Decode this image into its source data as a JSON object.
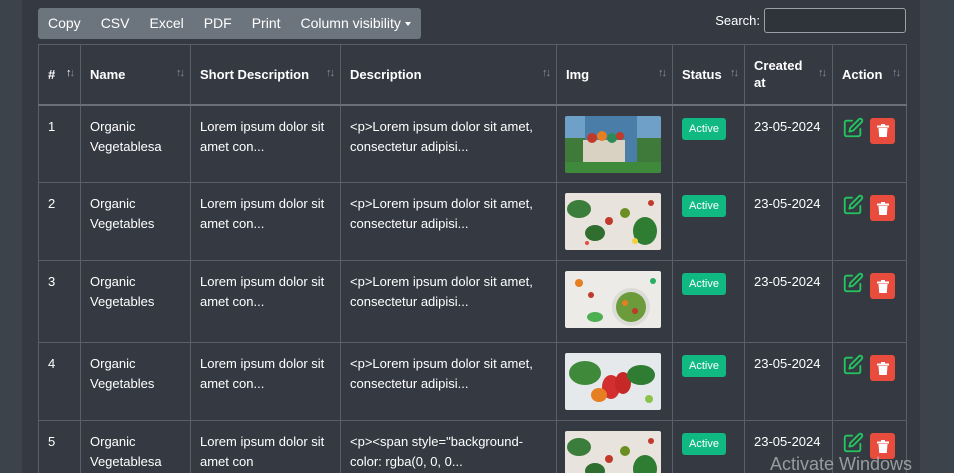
{
  "toolbar": {
    "buttons": [
      "Copy",
      "CSV",
      "Excel",
      "PDF",
      "Print",
      "Column visibility"
    ]
  },
  "search": {
    "label": "Search:",
    "value": ""
  },
  "table": {
    "headers": [
      "#",
      "Name",
      "Short Description",
      "Description",
      "Img",
      "Status",
      "Created at",
      "Action"
    ],
    "rows": [
      {
        "id": "1",
        "name": "Organic Vegetablesa",
        "short": "Lorem ipsum dolor sit amet con...",
        "desc": "<p>Lorem ipsum dolor sit amet, consectetur adipisi...",
        "img": "basket-of-vegetables-photo",
        "status": "Active",
        "created": "23-05-2024"
      },
      {
        "id": "2",
        "name": "Organic Vegetables",
        "short": "Lorem ipsum dolor sit amet con...",
        "desc": "<p>Lorem ipsum dolor sit amet, consectetur adipisi...",
        "img": "vegetables-flatlay-photo",
        "status": "Active",
        "created": "23-05-2024"
      },
      {
        "id": "3",
        "name": "Organic Vegetables",
        "short": "Lorem ipsum dolor sit amet con...",
        "desc": "<p>Lorem ipsum dolor sit amet, consectetur adipisi...",
        "img": "salad-bowl-photo",
        "status": "Active",
        "created": "23-05-2024"
      },
      {
        "id": "4",
        "name": "Organic Vegetables",
        "short": "Lorem ipsum dolor sit amet con...",
        "desc": "<p>Lorem ipsum dolor sit amet, consectetur adipisi...",
        "img": "peppers-vegetables-photo",
        "status": "Active",
        "created": "23-05-2024"
      },
      {
        "id": "5",
        "name": "Organic Vegetablesa",
        "short": "Lorem ipsum dolor sit amet con",
        "desc": "<p><span style=\"background-color: rgba(0, 0, 0...",
        "img": "vegetables-flatlay-photo",
        "status": "Active",
        "created": "23-05-2024"
      }
    ]
  },
  "colors": {
    "background": "#3d434b",
    "panel": "#353a42",
    "toolbar": "#6c757d",
    "active_badge": "#10b981",
    "edit_icon": "#22c55e",
    "delete_button": "#e74c3c"
  },
  "watermark": "Activate Windows"
}
